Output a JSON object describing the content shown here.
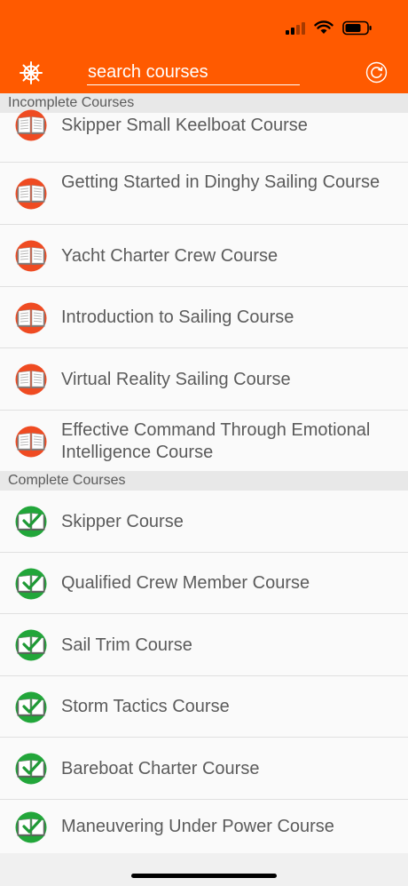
{
  "header": {
    "search_placeholder": "search courses"
  },
  "colors": {
    "accent": "#ff5a00",
    "incomplete_icon": "#ef4b22",
    "complete_icon": "#22a63a"
  },
  "icons": {
    "menu": "helm-icon",
    "refresh": "refresh-icon",
    "incomplete": "open-book-icon",
    "complete": "book-check-icon"
  },
  "sections": {
    "incomplete_title": "Incomplete Courses",
    "complete_title": "Complete Courses"
  },
  "incomplete_courses": [
    "Skipper Small Keelboat Course",
    "Getting Started in Dinghy Sailing Course",
    "Yacht Charter Crew Course",
    "Introduction to Sailing Course",
    "Virtual Reality Sailing Course",
    "Effective Command Through Emotional Intelligence Course"
  ],
  "complete_courses": [
    "Skipper Course",
    "Qualified Crew Member Course",
    "Sail Trim Course",
    "Storm Tactics Course",
    "Bareboat Charter Course",
    "Maneuvering Under Power Course"
  ]
}
